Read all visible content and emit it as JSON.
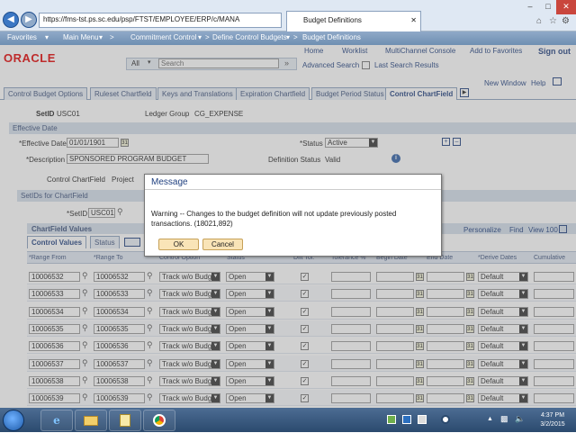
{
  "browser": {
    "url": "https://fms-tst.ps.sc.edu/psp/FTST/EMPLOYEE/ERP/c/MANA",
    "tab_title": "Budget Definitions"
  },
  "psnav": {
    "favorites": "Favorites",
    "main_menu": "Main Menu",
    "commitment_control": "Commitment Control",
    "define_budgets": "Define Control Budgets",
    "current": "Budget Definitions"
  },
  "header": {
    "logo": "ORACLE",
    "links": [
      "Home",
      "Worklist",
      "MultiChannel Console",
      "Add to Favorites",
      "Sign out"
    ],
    "search_scope": "All",
    "search_label": "Search",
    "advanced_search": "Advanced Search",
    "last_results": "Last Search Results"
  },
  "page_links": {
    "new_window": "New Window",
    "help": "Help"
  },
  "subtabs": [
    "Control Budget Options",
    "Ruleset Chartfield",
    "Keys and Translations",
    "Expiration Chartfield",
    "Budget Period Status",
    "Control ChartField"
  ],
  "form": {
    "setid_label": "SetID",
    "setid_value": "USC01",
    "ledger_group_label": "Ledger Group",
    "ledger_group_value": "CG_EXPENSE",
    "section_effective": "Effective Date",
    "eff_date_label": "*Effective Date",
    "eff_date_value": "01/01/1901",
    "status_label": "*Status",
    "status_value": "Active",
    "description_label": "*Description",
    "description_value": "SPONSORED PROGRAM BUDGET",
    "definition_status_label": "Definition Status",
    "definition_status_value": "Valid",
    "control_chartfield_label": "Control ChartField",
    "control_chartfield_value": "Project",
    "section_setids": "SetIDs for ChartField",
    "setid2_label": "*SetID",
    "setid2_value": "USC01"
  },
  "grid": {
    "title": "ChartField Values",
    "tabs": [
      "Control Values",
      "Status"
    ],
    "nav": [
      "Personalize",
      "Find",
      "View 100"
    ],
    "columns": [
      "*Range From",
      "*Range To",
      "Control Option",
      "Status",
      "Dflt Tol.",
      "Tolerance %",
      "Begin Date",
      "End Date",
      "*Derive Dates",
      "Cumulative"
    ],
    "rows": [
      {
        "from": "10006532",
        "to": "10006532",
        "option": "Track w/o Budg",
        "status": "Open",
        "derive": "Default"
      },
      {
        "from": "10006533",
        "to": "10006533",
        "option": "Track w/o Budg",
        "status": "Open",
        "derive": "Default"
      },
      {
        "from": "10006534",
        "to": "10006534",
        "option": "Track w/o Budg",
        "status": "Open",
        "derive": "Default"
      },
      {
        "from": "10006535",
        "to": "10006535",
        "option": "Track w/o Budg",
        "status": "Open",
        "derive": "Default"
      },
      {
        "from": "10006536",
        "to": "10006536",
        "option": "Track w/o Budg",
        "status": "Open",
        "derive": "Default"
      },
      {
        "from": "10006537",
        "to": "10006537",
        "option": "Track w/o Budg",
        "status": "Open",
        "derive": "Default"
      },
      {
        "from": "10006538",
        "to": "10006538",
        "option": "Track w/o Budg",
        "status": "Open",
        "derive": "Default"
      },
      {
        "from": "10006539",
        "to": "10006539",
        "option": "Track w/o Budg",
        "status": "Open",
        "derive": "Default"
      }
    ]
  },
  "dialog": {
    "title": "Message",
    "message": "Warning -- Changes to the budget definition will not update previously posted transactions. (18021,892)",
    "ok": "OK",
    "cancel": "Cancel"
  },
  "taskbar": {
    "time": "4:37 PM",
    "date": "3/2/2015"
  }
}
